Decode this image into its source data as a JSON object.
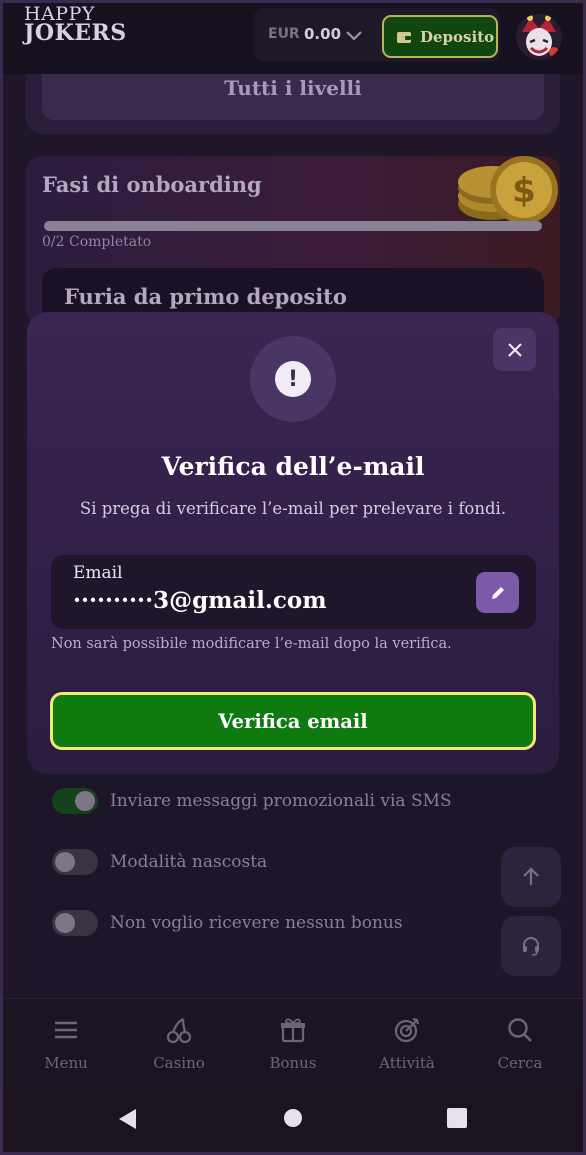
{
  "header": {
    "logo_line1": "HAPPY",
    "logo_line2": "JOKERS",
    "currency": "EUR",
    "balance": "0.00",
    "deposit_label": "Deposito"
  },
  "background": {
    "levels_button": "Tutti i livelli",
    "onboarding_title": "Fasi di onboarding",
    "onboarding_progress": 0,
    "onboarding_progress_text": "0/2 Completato",
    "deposit_card_title": "Furia da primo deposito"
  },
  "modal": {
    "title": "Verifica dell’e-mail",
    "subtitle": "Si prega di verificare l’e-mail per prelevare i fondi.",
    "email_label": "Email",
    "email_value": "··········3@gmail.com",
    "note": "Non sarà possibile modificare l’e-mail dopo la verifica.",
    "verify_button": "Verifica email"
  },
  "settings": {
    "toggles": [
      {
        "label": "Inviare messaggi promozionali via SMS",
        "on": true
      },
      {
        "label": "Modalità nascosta",
        "on": false
      },
      {
        "label": "Non voglio ricevere nessun bonus",
        "on": false
      }
    ]
  },
  "nav": {
    "items": [
      {
        "label": "Menu",
        "icon": "hamburger-icon"
      },
      {
        "label": "Casino",
        "icon": "cherry-icon"
      },
      {
        "label": "Bonus",
        "icon": "gift-icon"
      },
      {
        "label": "Attività",
        "icon": "target-icon"
      },
      {
        "label": "Cerca",
        "icon": "search-icon"
      }
    ]
  },
  "colors": {
    "accent_green": "#0f7a10",
    "button_border": "#f2e77a",
    "modal_bg": "#3a2652"
  }
}
